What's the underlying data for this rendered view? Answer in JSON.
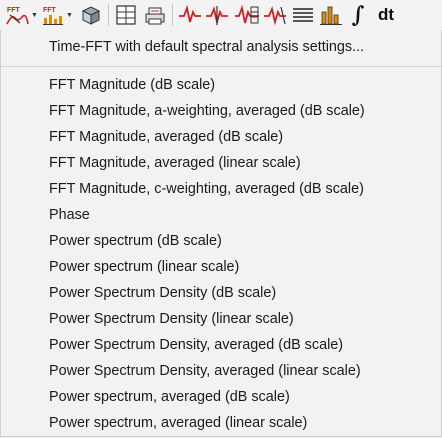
{
  "toolbar": {
    "buttons": [
      {
        "icon": "fft-curve-icon",
        "label": "FFT",
        "has_dropdown": true
      },
      {
        "icon": "fft-chart-icon",
        "label": "FFT",
        "has_dropdown": true
      },
      {
        "icon": "stacked-box-icon"
      },
      {
        "icon": "grid-icon"
      },
      {
        "icon": "printer-icon"
      },
      {
        "icon": "signal-icon"
      },
      {
        "icon": "signal-marker-icon"
      },
      {
        "icon": "signal-filter-icon"
      },
      {
        "icon": "signal-derivative-icon"
      },
      {
        "icon": "lines-icon"
      },
      {
        "icon": "bars-icon"
      },
      {
        "icon": "integral-icon",
        "label": "∫"
      },
      {
        "icon": "dt-icon",
        "label": "dt"
      }
    ]
  },
  "menu": {
    "header_item": "Time-FFT with default spectral analysis settings...",
    "items": [
      "FFT Magnitude (dB scale)",
      "FFT Magnitude, a-weighting, averaged (dB scale)",
      "FFT Magnitude, averaged (dB scale)",
      "FFT Magnitude, averaged (linear scale)",
      "FFT Magnitude, c-weighting, averaged (dB scale)",
      "Phase",
      "Power spectrum (dB scale)",
      "Power spectrum (linear scale)",
      "Power Spectrum Density (dB scale)",
      "Power Spectrum Density (linear scale)",
      "Power Spectrum Density, averaged (dB scale)",
      "Power Spectrum Density, averaged (linear scale)",
      "Power spectrum, averaged (dB scale)",
      "Power spectrum, averaged (linear scale)"
    ]
  },
  "colors": {
    "accent_red": "#d21f1f",
    "accent_orange": "#e08a00",
    "text": "#1a1a1a"
  }
}
